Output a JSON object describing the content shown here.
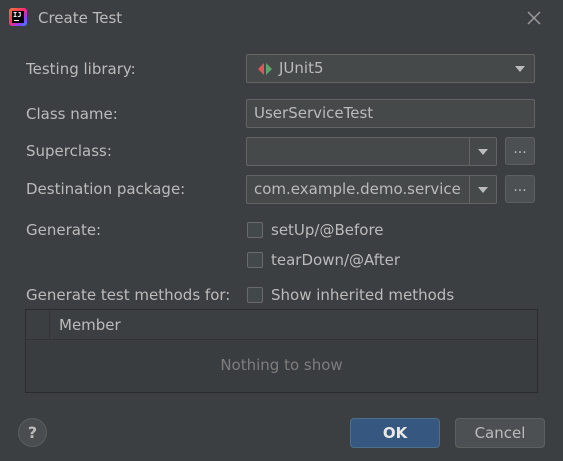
{
  "window": {
    "title": "Create Test",
    "app_icon_text": "IJ",
    "close_icon": "close-icon"
  },
  "form": {
    "testing_library": {
      "label": "Testing library:",
      "value": "JUnit5",
      "icon": "junit-icon"
    },
    "class_name": {
      "label": "Class name:",
      "value": "UserServiceTest"
    },
    "superclass": {
      "label": "Superclass:",
      "value": "",
      "browse_label": "..."
    },
    "destination_package": {
      "label": "Destination package:",
      "value": "com.example.demo.service",
      "browse_label": "..."
    },
    "generate": {
      "label": "Generate:",
      "options": [
        {
          "label": "setUp/@Before",
          "checked": false
        },
        {
          "label": "tearDown/@After",
          "checked": false
        }
      ]
    },
    "generate_methods": {
      "label": "Generate test methods for:",
      "show_inherited": {
        "label": "Show inherited methods",
        "checked": false
      }
    }
  },
  "members_table": {
    "columns": [
      "Member"
    ],
    "empty_text": "Nothing to show"
  },
  "footer": {
    "help_label": "?",
    "ok_label": "OK",
    "cancel_label": "Cancel"
  },
  "colors": {
    "background": "#3c3f41",
    "field": "#45494a",
    "primary_button": "#365880",
    "text": "#bbbbbb",
    "junit_green": "#59a869",
    "junit_red": "#e05555"
  }
}
